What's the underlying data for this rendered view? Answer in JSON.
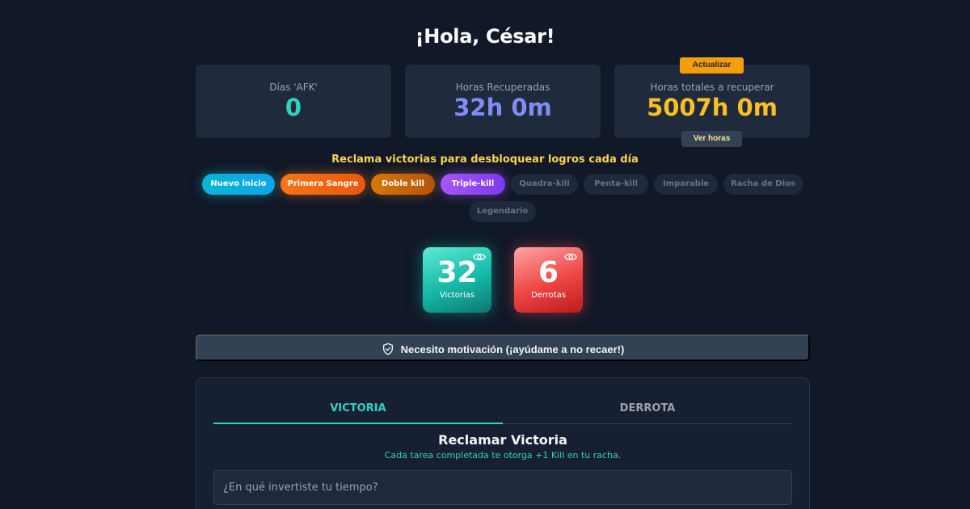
{
  "greeting": "¡Hola, César!",
  "stats": {
    "afk": {
      "label": "Días 'AFK'",
      "value": "0"
    },
    "recovered": {
      "label": "Horas Recuperadas",
      "value": "32h 0m"
    },
    "total": {
      "label": "Horas totales a recuperar",
      "value": "5007h 0m"
    },
    "update_button": "Actualizar",
    "view_hours_button": "Ver horas"
  },
  "achievements": {
    "title": "Reclama victorias para desbloquear logros cada día",
    "items": [
      {
        "label": "Nuevo inicio",
        "unlocked": true,
        "color": "#06b6d4"
      },
      {
        "label": "Primera Sangre",
        "unlocked": true,
        "color": "#f97316"
      },
      {
        "label": "Doble kill",
        "unlocked": true,
        "color": "#d97706"
      },
      {
        "label": "Triple-kill",
        "unlocked": true,
        "color": "#a855f7"
      },
      {
        "label": "Quadra-kill",
        "unlocked": false
      },
      {
        "label": "Penta-kill",
        "unlocked": false
      },
      {
        "label": "Imparable",
        "unlocked": false
      },
      {
        "label": "Racha de Dios",
        "unlocked": false
      },
      {
        "label": "Legendario",
        "unlocked": false
      }
    ]
  },
  "scores": {
    "wins": {
      "value": "32",
      "label": "Victorias",
      "icon": "eye-icon",
      "color": "#14b8a6"
    },
    "losses": {
      "value": "6",
      "label": "Derrotas",
      "icon": "eye-icon",
      "color": "#ef4444"
    }
  },
  "motivation_button": {
    "label": "Necesito motivación (¡ayúdame a no recaer!)",
    "icon": "shield-check-icon"
  },
  "panel": {
    "tabs": [
      {
        "label": "VICTORIA",
        "active": true
      },
      {
        "label": "DERROTA",
        "active": false
      }
    ],
    "title": "Reclamar Victoria",
    "subtitle": "Cada tarea completada te otorga +1 Kill en tu racha.",
    "input_placeholder": "¿En qué invertiste tu tiempo?",
    "input_value": ""
  },
  "colors": {
    "background": "#111827",
    "card": "#1f2a3c",
    "accent_teal": "#2dd4bf",
    "accent_indigo": "#818cf8",
    "accent_amber": "#fbbf24"
  }
}
